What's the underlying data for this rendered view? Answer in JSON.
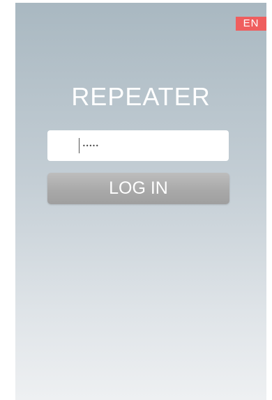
{
  "header": {
    "language_badge": "EN"
  },
  "main": {
    "title": "REPEATER",
    "password_field": {
      "value": "•••••",
      "placeholder": ""
    },
    "login_button_label": "LOG IN"
  },
  "colors": {
    "badge": "#ef5e5e",
    "background_top": "#a9b8c1",
    "background_bottom": "#eef0f2",
    "button": "#a9a9a9"
  }
}
